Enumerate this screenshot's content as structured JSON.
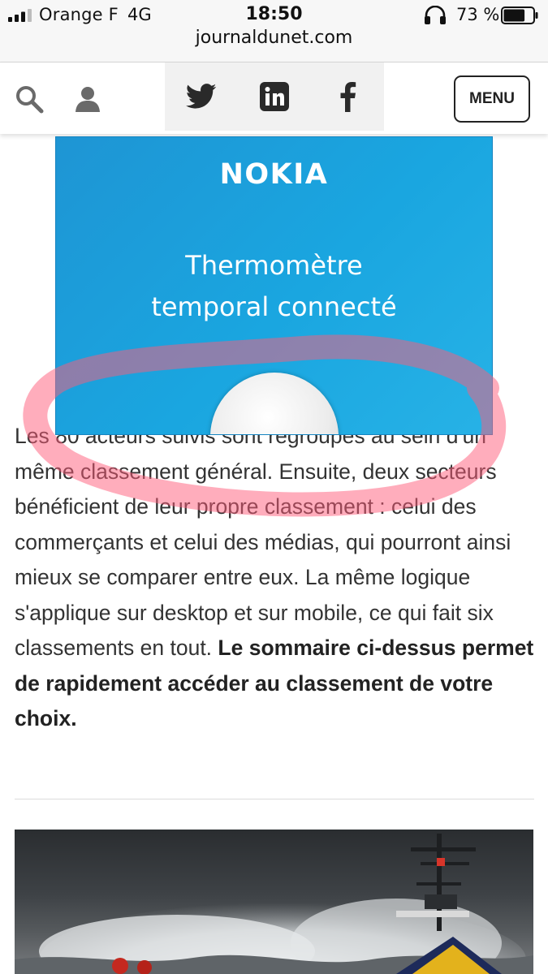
{
  "status_bar": {
    "carrier": "Orange F",
    "network": "4G",
    "time": "18:50",
    "url": "journaldunet.com",
    "battery": "73 %",
    "battery_level": 0.73
  },
  "header": {
    "menu_label": "MENU"
  },
  "ad": {
    "brand": "NOKIA",
    "line1": "Thermomètre",
    "line2": "temporal connecté",
    "background": "#1aa6e0"
  },
  "article": {
    "paragraph": "Les 80 acteurs suivis sont regroupés au sein d'un même classement général. Ensuite, deux secteurs bénéficient de leur propre classement : celui des commerçants et celui des médias, qui pourront ainsi mieux se comparer entre eux. La même logique s'applique sur desktop et sur mobile, ce qui fait six classements en tout.",
    "bold_text": "Le sommaire ci-dessus permet de rapidement accéder au classement de votre choix."
  },
  "colors": {
    "annotation": "#ff5b7a",
    "text": "#333333"
  },
  "icons": [
    "signal-icon",
    "headphones-icon",
    "battery-icon",
    "search-icon",
    "user-icon",
    "twitter-icon",
    "linkedin-icon",
    "facebook-icon"
  ]
}
